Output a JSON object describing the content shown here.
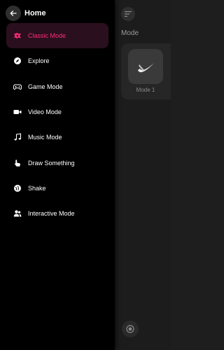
{
  "colors": {
    "accent": "#ff2d78",
    "drawer_bg": "#000000",
    "active_bg": "#2a0f1e",
    "background": "#1c1c1c"
  },
  "drawer": {
    "title": "Home",
    "back_icon": "arrow-left-icon",
    "items": [
      {
        "label": "Classic Mode",
        "icon": "classic-mode-icon",
        "active": true
      },
      {
        "label": "Explore",
        "icon": "compass-icon",
        "active": false
      },
      {
        "label": "Game Mode",
        "icon": "gamepad-icon",
        "active": false
      },
      {
        "label": "Video Mode",
        "icon": "video-camera-icon",
        "active": false
      },
      {
        "label": "Music Mode",
        "icon": "music-note-icon",
        "active": false
      },
      {
        "label": "Draw Something",
        "icon": "hand-pointer-icon",
        "active": false
      },
      {
        "label": "Shake",
        "icon": "shake-icon",
        "active": false
      },
      {
        "label": "Interactive Mode",
        "icon": "users-icon",
        "active": false
      }
    ]
  },
  "background": {
    "section_title": "Mode",
    "card": {
      "label": "Mode 1",
      "icon": "swoosh-icon"
    },
    "menu_icon": "sort-lines-icon",
    "bottom_icon": "record-icon"
  }
}
